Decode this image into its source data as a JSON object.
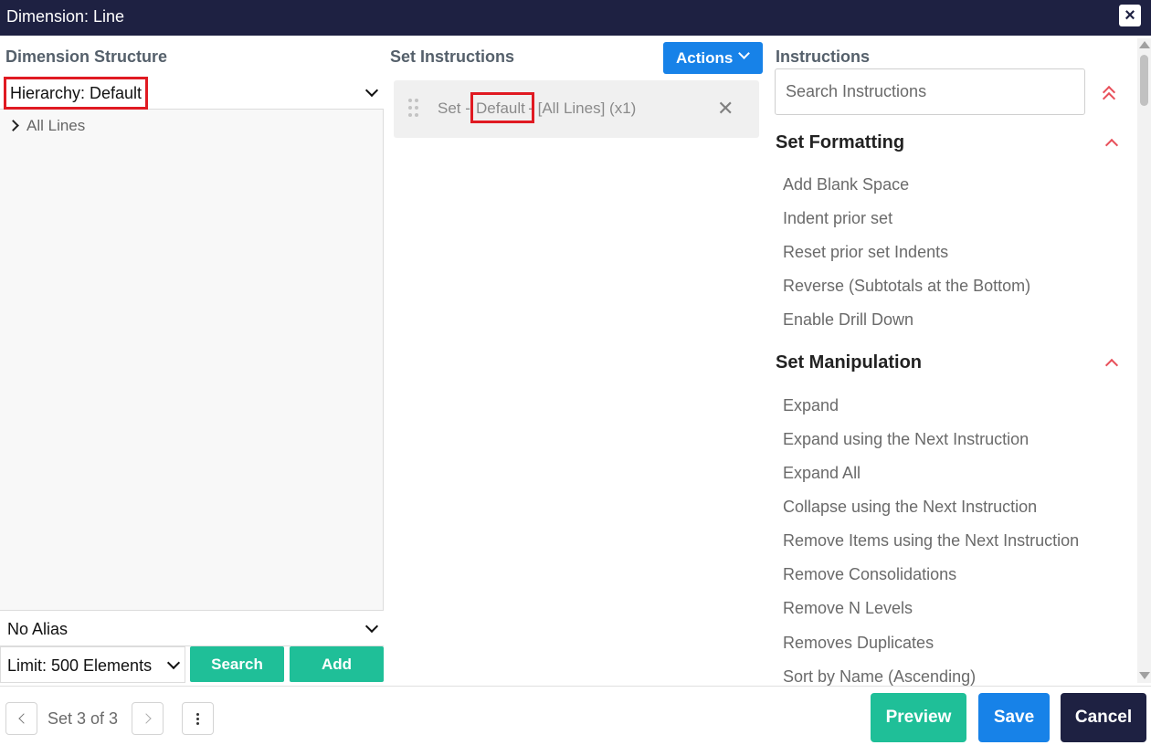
{
  "window": {
    "title": "Dimension: Line",
    "close_icon": "×"
  },
  "left": {
    "section_title": "Dimension Structure",
    "hierarchy_select": "Hierarchy: Default",
    "tree": [
      {
        "label": "All Lines",
        "expanded": false
      }
    ],
    "alias_select": "No Alias",
    "limit_select": "Limit: 500 Elements",
    "search_label": "Search",
    "add_label": "Add"
  },
  "middle": {
    "section_title": "Set Instructions",
    "actions_label": "Actions",
    "set_item": {
      "prefix": "Set - ",
      "hierarchy": "Default",
      "suffix": " - [All Lines] (x1)",
      "remove_icon": "✕"
    }
  },
  "right": {
    "section_title": "Instructions",
    "search_placeholder": "Search Instructions",
    "groups": [
      {
        "title": "Set Formatting",
        "items": [
          "Add Blank Space",
          "Indent prior set",
          "Reset prior set Indents",
          "Reverse (Subtotals at the Bottom)",
          "Enable Drill Down"
        ]
      },
      {
        "title": "Set Manipulation",
        "items": [
          "Expand",
          "Expand using the Next Instruction",
          "Expand All",
          "Collapse using the Next Instruction",
          "Remove Items using the Next Instruction",
          "Remove Consolidations",
          "Remove N Levels",
          "Removes Duplicates",
          "Sort by Name (Ascending)"
        ]
      }
    ]
  },
  "footer": {
    "pager_text": "Set 3 of 3",
    "preview_label": "Preview",
    "save_label": "Save",
    "cancel_label": "Cancel"
  },
  "colors": {
    "titlebar": "#1e2142",
    "teal": "#1fbf98",
    "blue": "#1782e8",
    "dark": "#1e2142",
    "highlight": "#e01a22",
    "caret": "#e8505a"
  },
  "icons": {
    "close": "close-icon",
    "expand_tree": "chevron-right-icon",
    "select_arrow": "chevron-down-icon",
    "drag": "drag-handle-icon",
    "collapse_all": "double-chevron-up-icon",
    "collapse_group": "chevron-up-icon",
    "prev": "chevron-left-icon",
    "next": "chevron-right-icon",
    "more": "kebab-icon"
  }
}
